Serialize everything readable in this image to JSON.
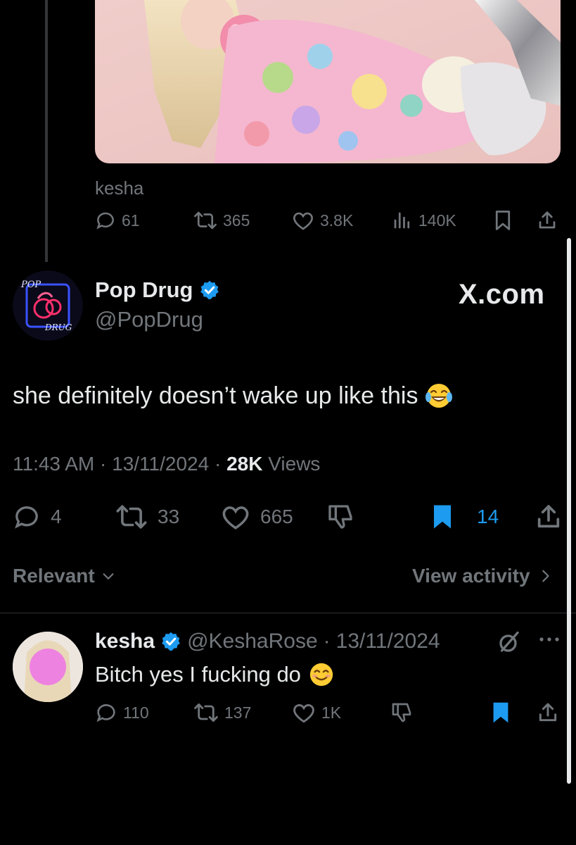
{
  "quoted_tweet": {
    "author": "kesha",
    "stats": {
      "replies": "61",
      "reposts": "365",
      "likes": "3.8K",
      "views": "140K"
    }
  },
  "main_tweet": {
    "display_name": "Pop Drug",
    "handle": "@PopDrug",
    "avatar_text_top": "POP",
    "avatar_text_bottom": "DRUG",
    "watermark": "X.com",
    "text": "she definitely doesn’t wake up like this",
    "time": "11:43 AM",
    "date": "13/11/2024",
    "views_count": "28K",
    "views_label": "Views",
    "sep": "·",
    "stats": {
      "replies": "4",
      "reposts": "33",
      "likes": "665",
      "bookmarks": "14"
    }
  },
  "sort": {
    "label": "Relevant",
    "view_activity": "View activity"
  },
  "reply": {
    "display_name": "kesha",
    "handle": "@KeshaRose",
    "date": "13/11/2024",
    "text": "Bitch yes I fucking do",
    "stats": {
      "replies": "110",
      "reposts": "137",
      "likes": "1K"
    }
  },
  "colors": {
    "background": "#000000",
    "text": "#e7e9ea",
    "muted": "#71767b",
    "accent": "#1d9bf0"
  },
  "icons": {
    "reply": "reply-icon",
    "repost": "repost-icon",
    "like": "heart-icon",
    "views": "views-icon",
    "bookmark": "bookmark-icon",
    "share": "share-icon",
    "dislike": "downvote-icon",
    "verified": "verified-badge-icon",
    "grok": "grok-icon",
    "more": "more-icon"
  }
}
